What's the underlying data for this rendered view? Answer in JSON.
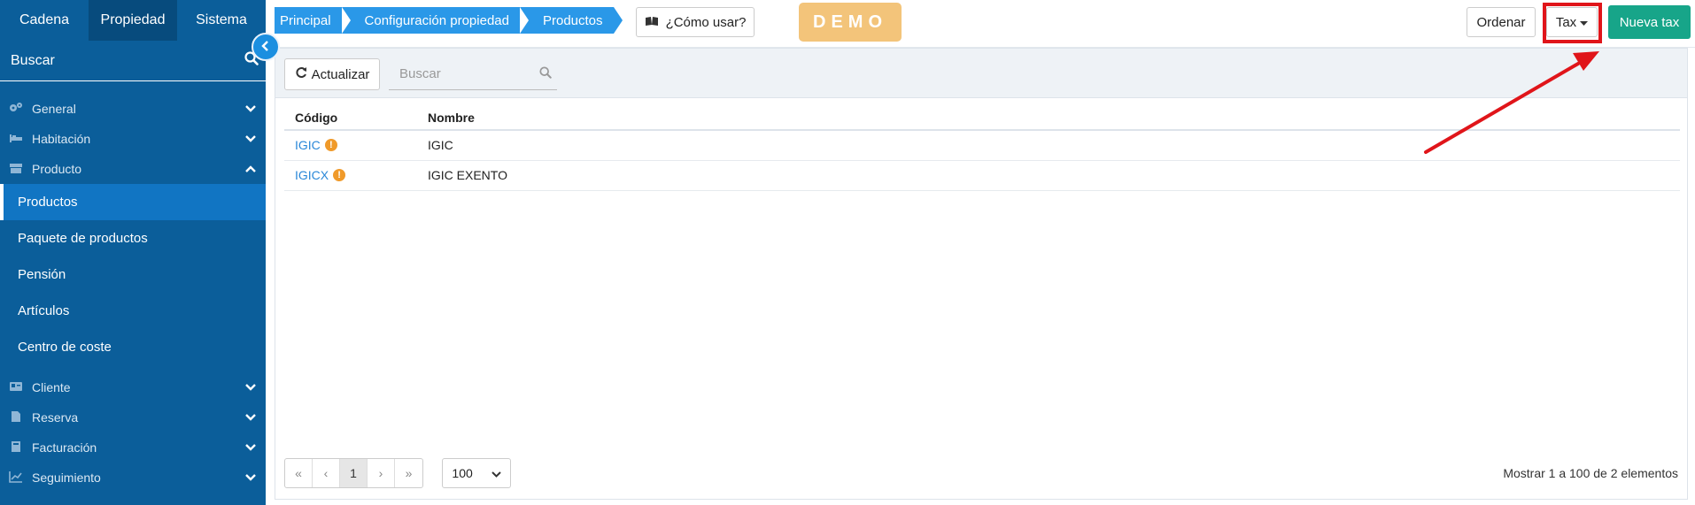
{
  "sidebar": {
    "tabs": [
      "Cadena",
      "Propiedad",
      "Sistema"
    ],
    "search_placeholder": "Buscar",
    "groups_top": [
      {
        "label": "General",
        "icon": "cogs-icon"
      },
      {
        "label": "Habitación",
        "icon": "bed-icon"
      },
      {
        "label": "Producto",
        "icon": "box-icon"
      }
    ],
    "items": [
      "Productos",
      "Paquete de productos",
      "Pensión",
      "Artículos",
      "Centro de coste"
    ],
    "groups_bottom": [
      {
        "label": "Cliente",
        "icon": "id-card-icon"
      },
      {
        "label": "Reserva",
        "icon": "file-icon"
      },
      {
        "label": "Facturación",
        "icon": "calculator-icon"
      },
      {
        "label": "Seguimiento",
        "icon": "chart-icon"
      }
    ]
  },
  "breadcrumb": [
    "Principal",
    "Configuración propiedad",
    "Productos"
  ],
  "header": {
    "howto_label": "¿Cómo usar?",
    "demo_label": "DEMO",
    "ordenar_label": "Ordenar",
    "tax_label": "Tax",
    "nueva_label": "Nueva tax"
  },
  "toolbar": {
    "refresh_label": "Actualizar",
    "search_placeholder": "Buscar"
  },
  "table": {
    "columns": [
      "Código",
      "Nombre"
    ],
    "rows": [
      {
        "code": "IGIC",
        "name": "IGIC"
      },
      {
        "code": "IGICX",
        "name": "IGIC EXENTO"
      }
    ]
  },
  "pagination": {
    "first": "«",
    "prev": "‹",
    "current": "1",
    "next": "›",
    "last": "»",
    "per_page": "100",
    "summary": "Mostrar 1 a 100 de 2 elementos"
  },
  "colors": {
    "sidebar": "#0b5e9a",
    "breadcrumb": "#2a98e8",
    "primary_action": "#17a589",
    "highlight": "#e0151a"
  }
}
